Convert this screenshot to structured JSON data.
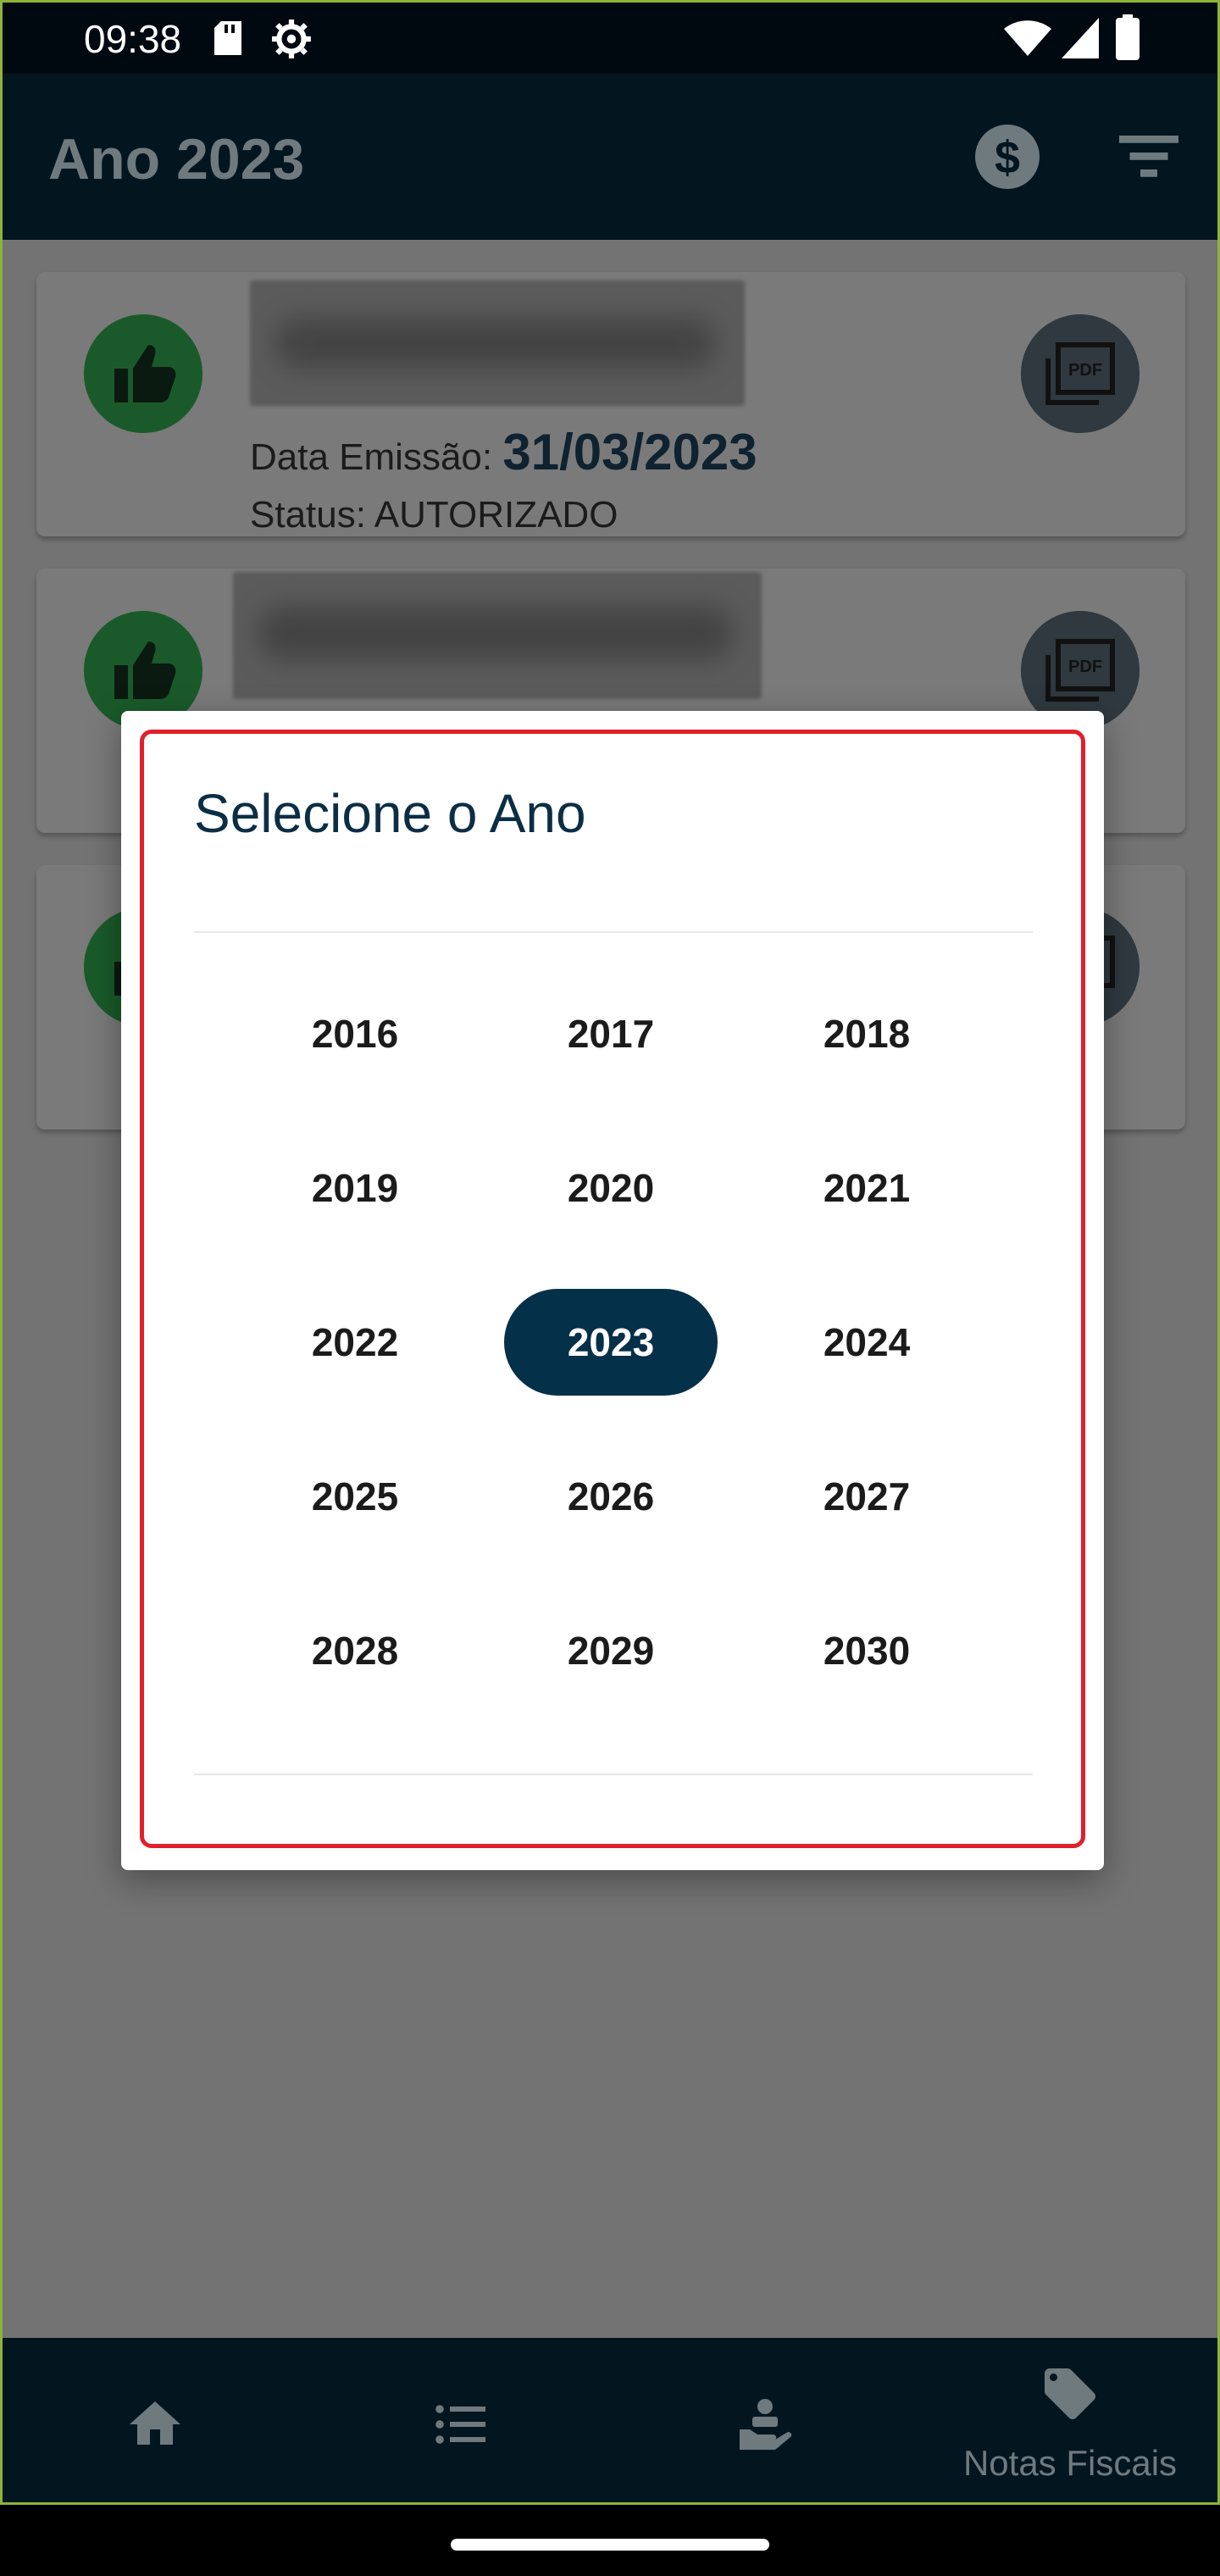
{
  "status_bar": {
    "time": "09:38"
  },
  "app_bar": {
    "title": "Ano 2023"
  },
  "cards": [
    {
      "label_date": "Data Emissão: ",
      "date": "31/03/2023",
      "status": "Status: AUTORIZADO"
    }
  ],
  "dialog": {
    "title": "Selecione o Ano",
    "years": [
      "2016",
      "2017",
      "2018",
      "2019",
      "2020",
      "2021",
      "2022",
      "2023",
      "2024",
      "2025",
      "2026",
      "2027",
      "2028",
      "2029",
      "2030"
    ],
    "selected_year": "2023"
  },
  "bottom_nav": {
    "items": [
      {
        "icon": "home-icon",
        "label": ""
      },
      {
        "icon": "list-icon",
        "label": ""
      },
      {
        "icon": "hand-coins-icon",
        "label": ""
      },
      {
        "icon": "tag-icon",
        "label": "Notas Fiscais"
      }
    ],
    "active_index": 3
  },
  "colors": {
    "app_bar": "#031620",
    "selected_year": "#053049",
    "highlight_border": "#e0202a",
    "thumb_green": "#1a5a2a"
  }
}
